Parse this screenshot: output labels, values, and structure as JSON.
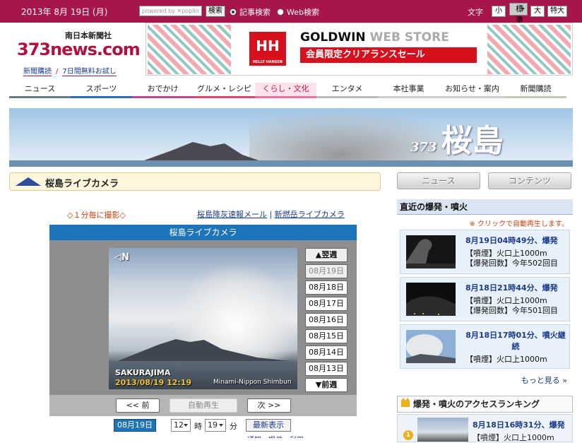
{
  "topbar": {
    "date": "2013年 8月 19日 (月)",
    "poplin_label": "powered by ✕poplin",
    "search_button": "検索",
    "radio_article": "記事検索",
    "radio_web": "Web検索",
    "font_size_label": "文字",
    "font_sizes": [
      "小",
      "標準",
      "大",
      "特大"
    ],
    "font_size_selected": "標準"
  },
  "logo": {
    "publisher": "南日本新聞社",
    "site": "373news.com"
  },
  "header_links": [
    "新聞購読",
    "7日間無料お試し"
  ],
  "ad": {
    "brand": "HH",
    "brand_sub": "HELLY HANSEN",
    "store": "GOLDWIN",
    "store_suffix": " WEB STORE",
    "sale": "会員限定クリアランスセール"
  },
  "nav": [
    {
      "label": "ニュース",
      "color": "#6b7a8c"
    },
    {
      "label": "スポーツ",
      "color": "#2a6fb4"
    },
    {
      "label": "おでかけ",
      "color": "#b54b8a"
    },
    {
      "label": "グルメ・レシピ",
      "color": "#d84b6a"
    },
    {
      "label": "くらし・文化",
      "color": "#e8749a",
      "active": true
    },
    {
      "label": "エンタメ",
      "color": "#bbbbbb"
    },
    {
      "label": "本社事業",
      "color": "#cccccc"
    },
    {
      "label": "お知らせ・案内",
      "color": "#cccccc"
    },
    {
      "label": "新聞購読",
      "color": "#bcd1b0"
    }
  ],
  "banner": {
    "prefix": "373",
    "title": "桜島"
  },
  "camera_section": {
    "heading": "桜島ライブカメラ",
    "interval": "◇１分毎に撮影◇",
    "link_ash": "桜島降灰速報メール",
    "link_sep": "|",
    "link_shinmoe": "新燃岳ライブカメラ"
  },
  "side_tabs": [
    "ニュース",
    "コンテンツ"
  ],
  "viewer": {
    "title": "桜島ライブカメラ",
    "compass": "◁N",
    "location": "SAKURAJIMA",
    "timestamp": "2013/08/19 12:19",
    "credit": "Minami-Nippon Shimbun",
    "next_week": "▲翌週",
    "prev_week": "▼前週",
    "days": [
      "08月19日",
      "08月18日",
      "08月17日",
      "08月16日",
      "08月15日",
      "08月14日",
      "08月13日"
    ],
    "prev_button": "<< 前",
    "autoplay_button": "自動再生",
    "next_button": "次 >>",
    "date_value": "08月19日",
    "hour_value": "12",
    "hour_unit": "時",
    "minute_value": "19",
    "minute_unit": "分",
    "latest_button": "最新表示",
    "cut_text": "通知・提供・利用..."
  },
  "recent": {
    "heading": "直近の爆発・噴火",
    "note": "※ クリックで自動再生します。",
    "items": [
      {
        "title": "8月19日04時49分、爆発",
        "line1": "【噴煙】火口上1000m",
        "line2": "【爆発回数】今年502回目"
      },
      {
        "title": "8月18日21時44分、爆発",
        "line1": "【噴煙】火口上1000m",
        "line2": "【爆発回数】今年501回目"
      },
      {
        "title": "8月18日17時01分、噴火継続",
        "line1": "【噴煙】火口上1000m",
        "line2": ""
      }
    ],
    "more": "もっと見る »"
  },
  "ranking": {
    "heading": "爆発・噴火のアクセスランキング",
    "items": [
      {
        "rank": "1",
        "title": "8月18日16時31分、爆発",
        "line1": "【噴煙】火口上1000m"
      }
    ]
  }
}
